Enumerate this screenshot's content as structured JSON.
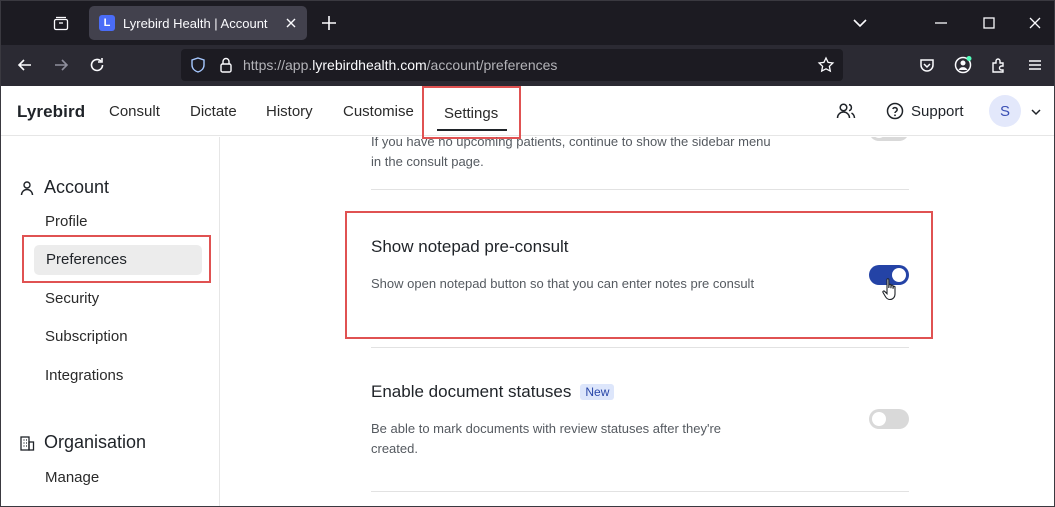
{
  "browser": {
    "tab_title": "Lyrebird Health | Account",
    "favicon_letter": "L",
    "url_prefix": "https://app.",
    "url_host": "lyrebirdhealth.com",
    "url_path": "/account/preferences"
  },
  "header": {
    "brand": "Lyrebird",
    "nav": {
      "consult": "Consult",
      "dictate": "Dictate",
      "history": "History",
      "customise": "Customise",
      "settings": "Settings"
    },
    "support_label": "Support",
    "avatar_initial": "S"
  },
  "sidebar": {
    "account_section": "Account",
    "items": [
      "Profile",
      "Preferences",
      "Security",
      "Subscription",
      "Integrations"
    ],
    "organisation_section": "Organisation",
    "org_items": [
      "Manage"
    ]
  },
  "settings": [
    {
      "title": "",
      "description": "If you have no upcoming patients, continue to show the sidebar menu in the consult page.",
      "enabled": false
    },
    {
      "title": "Show notepad pre-consult",
      "description": "Show open notepad button so that you can enter notes pre consult",
      "enabled": true
    },
    {
      "title": "Enable document statuses",
      "badge": "New",
      "description": "Be able to mark documents with review statuses after they're created.",
      "enabled": false
    }
  ],
  "colors": {
    "accent": "#2443a6",
    "highlight": "#e05252",
    "badge_bg": "#dde6fb"
  }
}
